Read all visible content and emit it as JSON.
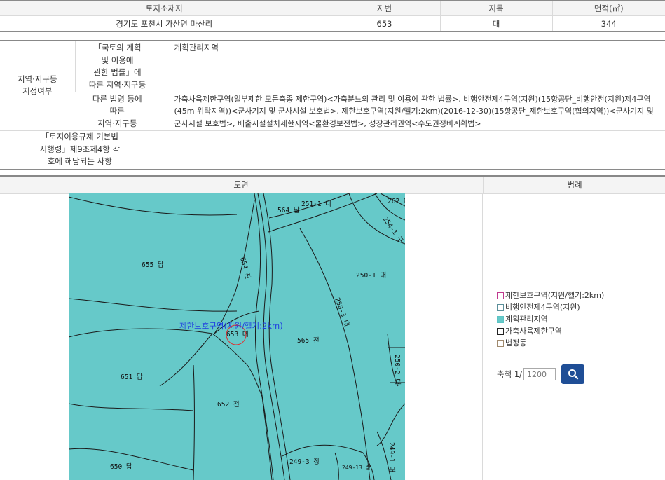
{
  "land": {
    "headers": [
      "토지소재지",
      "지번",
      "지목",
      "면적(㎡)"
    ],
    "location": "경기도 포천시 가산면 마산리",
    "lot": "653",
    "category": "대",
    "area": "344"
  },
  "zoning": {
    "section_label_line1": "지역·지구등",
    "section_label_line2": "지정여부",
    "row1_label": [
      "「국토의 계획",
      "및 이용에",
      "관한 법률」에",
      "따른 지역·지구등"
    ],
    "row1_value": "계획관리지역",
    "row2_label": [
      "다른 법령 등에",
      "따른",
      "지역·지구등"
    ],
    "row2_value": "가축사육제한구역(일부제한 모든축종 제한구역)<가축분뇨의 관리 및 이용에 관한 법률>, 비행안전제4구역(지원)(15항공단_비행안전(지원)제4구역(45m 위탁지역))<군사기지 및 군사시설 보호법>, 제한보호구역(지원/헬기:2km)(2016-12-30)(15항공단_제한보호구역(협의지역))<군사기지 및 군사시설 보호법>, 배출시설설치제한지역<물환경보전법>, 성장관리권역<수도권정비계획법>",
    "row3_label": [
      "「토지이용규제 기본법",
      "시행령」제9조제4항 각",
      "호에 해당되는 사항"
    ],
    "row3_value": ""
  },
  "map_section": {
    "title": "도면",
    "legend_title": "범례",
    "overlay_label": "제한보호구역(지원/헬기:2km)",
    "parcels": [
      "564 답",
      "251-1 대",
      "262 대",
      "254-1 구",
      "655 답",
      "654 전",
      "250-1 대",
      "250-3 대",
      "653 대",
      "565 전",
      "250-2 대",
      "651 답",
      "652 전",
      "650 답",
      "249-3 장",
      "249-13 상",
      "249-1 대"
    ]
  },
  "legend": [
    {
      "label": "제한보호구역(지원/헬기:2km)",
      "border": "#c0398f",
      "fill": "#ffffff"
    },
    {
      "label": "비행안전제4구역(지원)",
      "border": "#5a8f9a",
      "fill": "#ffffff"
    },
    {
      "label": "계획관리지역",
      "border": "#5cc4c4",
      "fill": "#66c9c9"
    },
    {
      "label": "가축사육제한구역",
      "border": "#222222",
      "fill": "#ffffff"
    },
    {
      "label": "법정동",
      "border": "#a08a6e",
      "fill": "#ffffff"
    }
  ],
  "scale": {
    "label": "축척 1/",
    "value": "1200"
  }
}
